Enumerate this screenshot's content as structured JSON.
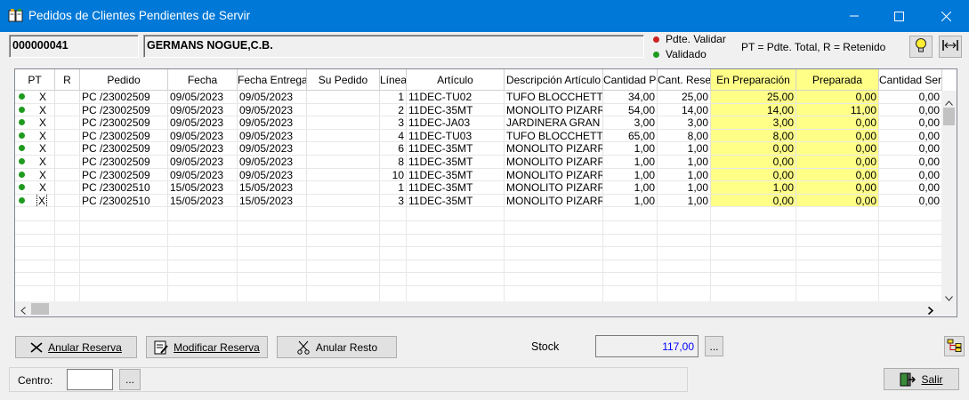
{
  "window": {
    "title": "Pedidos de Clientes Pendientes de Servir",
    "app_icon": "book-icon"
  },
  "header": {
    "client_code": "000000041",
    "client_name": "GERMANS NOGUE,C.B.",
    "legend_pending": "Pdte. Validar",
    "legend_validated": "Validado",
    "legend_note": "PT = Pdte. Total, R = Retenido",
    "colors": {
      "pending_dot": "#cc2222",
      "validated_dot": "#1f9a1f",
      "highlight": "#ffff88",
      "accent": "#0078d7"
    }
  },
  "grid": {
    "columns": [
      "PT",
      "R",
      "Pedido",
      "Fecha",
      "Fecha Entrega",
      "Su Pedido",
      "Línea",
      "Artículo",
      "Descripción Artículo",
      "Cantidad Pendiente",
      "Cant. Reservada",
      "En Preparación",
      "Preparada",
      "Cantidad Servida"
    ],
    "rows": [
      {
        "pt": "X",
        "r": "",
        "pedido": "PC /23002509",
        "fecha": "09/05/2023",
        "entrega": "09/05/2023",
        "su": "",
        "linea": "1",
        "art": "11DEC-TU02",
        "desc": "TUFO BLOCCHETT",
        "pend": "34,00",
        "res": "25,00",
        "prep": "25,00",
        "prepd": "0,00",
        "serv": "0,00"
      },
      {
        "pt": "X",
        "r": "",
        "pedido": "PC /23002509",
        "fecha": "09/05/2023",
        "entrega": "09/05/2023",
        "su": "",
        "linea": "2",
        "art": "11DEC-35MT",
        "desc": "MONOLITO PIZARR",
        "pend": "54,00",
        "res": "14,00",
        "prep": "14,00",
        "prepd": "11,00",
        "serv": "0,00"
      },
      {
        "pt": "X",
        "r": "",
        "pedido": "PC /23002509",
        "fecha": "09/05/2023",
        "entrega": "09/05/2023",
        "su": "",
        "linea": "3",
        "art": "11DEC-JA03",
        "desc": "JARDINERA GRAN",
        "pend": "3,00",
        "res": "3,00",
        "prep": "3,00",
        "prepd": "0,00",
        "serv": "0,00"
      },
      {
        "pt": "X",
        "r": "",
        "pedido": "PC /23002509",
        "fecha": "09/05/2023",
        "entrega": "09/05/2023",
        "su": "",
        "linea": "4",
        "art": "11DEC-TU03",
        "desc": "TUFO BLOCCHETT",
        "pend": "65,00",
        "res": "8,00",
        "prep": "8,00",
        "prepd": "0,00",
        "serv": "0,00"
      },
      {
        "pt": "X",
        "r": "",
        "pedido": "PC /23002509",
        "fecha": "09/05/2023",
        "entrega": "09/05/2023",
        "su": "",
        "linea": "6",
        "art": "11DEC-35MT",
        "desc": "MONOLITO PIZARR",
        "pend": "1,00",
        "res": "1,00",
        "prep": "0,00",
        "prepd": "0,00",
        "serv": "0,00"
      },
      {
        "pt": "X",
        "r": "",
        "pedido": "PC /23002509",
        "fecha": "09/05/2023",
        "entrega": "09/05/2023",
        "su": "",
        "linea": "8",
        "art": "11DEC-35MT",
        "desc": "MONOLITO PIZARR",
        "pend": "1,00",
        "res": "1,00",
        "prep": "0,00",
        "prepd": "0,00",
        "serv": "0,00"
      },
      {
        "pt": "X",
        "r": "",
        "pedido": "PC /23002509",
        "fecha": "09/05/2023",
        "entrega": "09/05/2023",
        "su": "",
        "linea": "10",
        "art": "11DEC-35MT",
        "desc": "MONOLITO PIZARR",
        "pend": "1,00",
        "res": "1,00",
        "prep": "0,00",
        "prepd": "0,00",
        "serv": "0,00"
      },
      {
        "pt": "X",
        "r": "",
        "pedido": "PC /23002510",
        "fecha": "15/05/2023",
        "entrega": "15/05/2023",
        "su": "",
        "linea": "1",
        "art": "11DEC-35MT",
        "desc": "MONOLITO PIZARR",
        "pend": "1,00",
        "res": "1,00",
        "prep": "1,00",
        "prepd": "0,00",
        "serv": "0,00"
      },
      {
        "pt": "X",
        "r": "",
        "pedido": "PC /23002510",
        "fecha": "15/05/2023",
        "entrega": "15/05/2023",
        "su": "",
        "linea": "3",
        "art": "11DEC-35MT",
        "desc": "MONOLITO PIZARR",
        "pend": "1,00",
        "res": "1,00",
        "prep": "0,00",
        "prepd": "0,00",
        "serv": "0,00"
      }
    ]
  },
  "actions": {
    "anular_reserva": "Anular Reserva",
    "modificar_reserva": "Modificar Reserva",
    "anular_resto": "Anular Resto",
    "stock_label": "Stock",
    "stock_value": "117,00",
    "ellipsis": "...",
    "centro_label": "Centro:",
    "centro_value": "",
    "salir": "Salir"
  }
}
